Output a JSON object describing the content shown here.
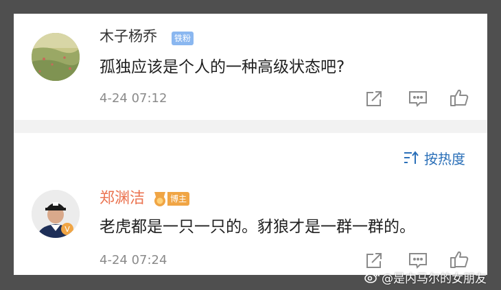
{
  "comment_1": {
    "username": "木子杨乔",
    "badge": "铁粉",
    "text": "孤独应该是个人的一种高级状态吧?",
    "time": "4-24 07:12"
  },
  "sort": {
    "label": "按热度"
  },
  "comment_2": {
    "username": "郑渊洁",
    "badge": "博主",
    "text": "老虎都是一只一只的。豺狼才是一群一群的。",
    "time": "4-24 07:24"
  },
  "watermark": {
    "text": "@是内马尔的女朋友"
  },
  "colors": {
    "username_highlight": "#eb7350",
    "fan_badge": "#8ab7f0",
    "host_badge": "#f0a545",
    "sort_link": "#2a6fb8",
    "timestamp": "#8a8a8a",
    "icon": "#8a8a8a"
  },
  "icons": [
    "share-icon",
    "comment-icon",
    "like-icon",
    "sort-icon",
    "medal-icon",
    "weibo-icon"
  ]
}
